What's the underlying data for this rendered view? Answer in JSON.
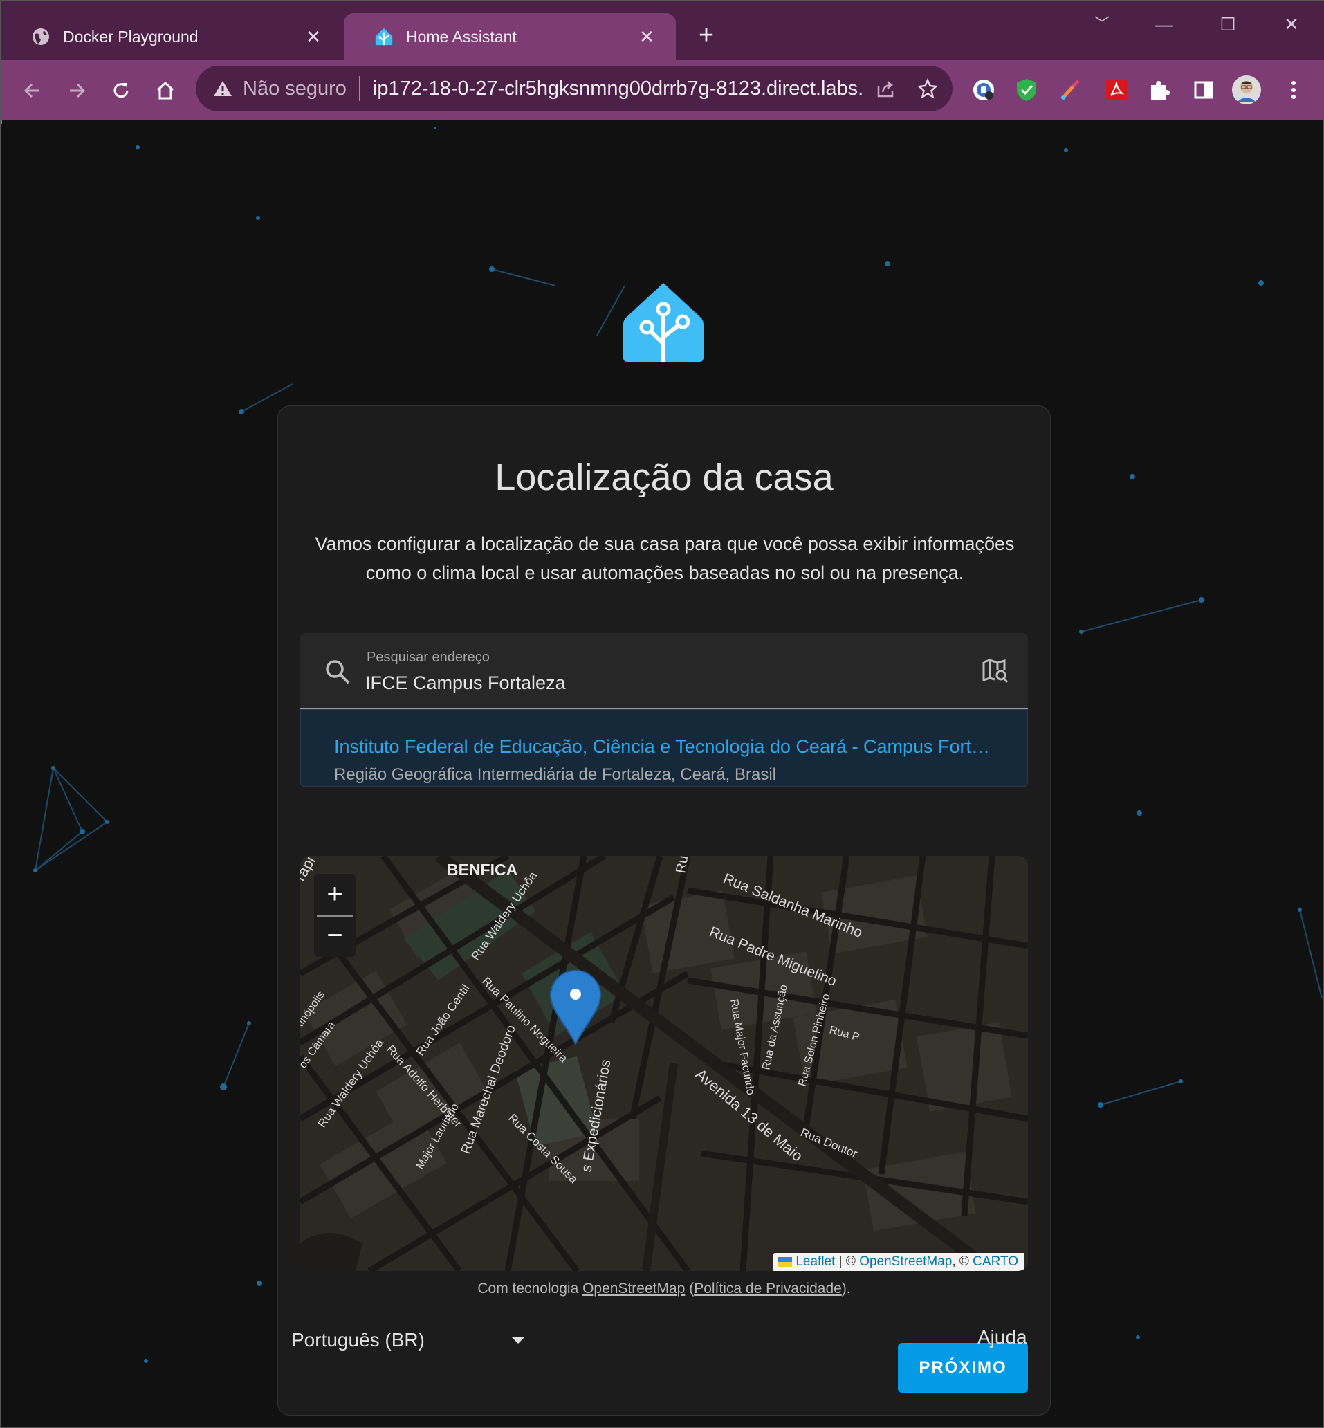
{
  "browser": {
    "tabs": [
      {
        "title": "Docker Playground",
        "icon": "globe-icon",
        "active": false
      },
      {
        "title": "Home Assistant",
        "icon": "home-assistant-icon",
        "active": true
      }
    ],
    "security_label": "Não seguro",
    "url": "ip172-18-0-27-clr5hgksnmng00drrb7g-8123.direct.labs....",
    "accent_color": "#7d3d74",
    "loading_progress": 0.5
  },
  "page": {
    "title": "Localização da casa",
    "description": "Vamos configurar a localização de sua casa para que você possa exibir informações como o clima local e usar automações baseadas no sol ou na presença.",
    "search": {
      "label": "Pesquisar endereço",
      "value": "IFCE Campus Fortaleza"
    },
    "result": {
      "title": "Instituto Federal de Educação, Ciência e Tecnologia do Ceará - Campus Fortaleza",
      "subtitle": "Região Geográfica Intermediária de Fortaleza, Ceará, Brasil"
    },
    "map": {
      "zoom_in": "+",
      "zoom_out": "−",
      "attribution": {
        "leaflet": "Leaflet",
        "osm": "OpenStreetMap",
        "carto": "CARTO",
        "separator": " | © ",
        "comma": ", © "
      },
      "labels": {
        "neighborhood": "BENFICA",
        "street_saldanha": "Rua Saldanha Marinho",
        "street_padre": "Rua Padre Miguelino",
        "street_waldery": "Rua Waldery Uchôa",
        "street_waldery2": "Rua Waldery Uchôa",
        "street_paulino": "Rua Paulino Nogueira",
        "street_joao": "Rua João Centil",
        "street_adolfo": "Rua Adolfo Herbster",
        "street_marechal": "Rua Marechal Deodoro",
        "street_costa": "Rua Costa Sousa",
        "street_expedicionarios": "s Expedicionários",
        "street_avenida": "Avenida 13 de Maio",
        "street_major_facundo": "Rua Major Facundo",
        "street_assuncao": "Rua da Assunção",
        "street_solon": "Rua Solon Pinheiro",
        "street_doutor": "Rua Doutor",
        "street_major_laurindo": "Major Laurindo",
        "street_camara": "os Câmara",
        "street_tinopolis": "tinópolis",
        "street_rua_p": "Rua P",
        "street_rua_top": "Ru",
        "street_rapi": "rapi"
      }
    },
    "powered_by": {
      "prefix": "Com tecnologia ",
      "osm": "OpenStreetMap",
      "open_paren": " (",
      "privacy": "Política de Privacidade",
      "close": ")."
    },
    "next_button": "PRÓXIMO",
    "language": "Português (BR)",
    "help": "Ajuda",
    "primary_color": "#039be5"
  }
}
